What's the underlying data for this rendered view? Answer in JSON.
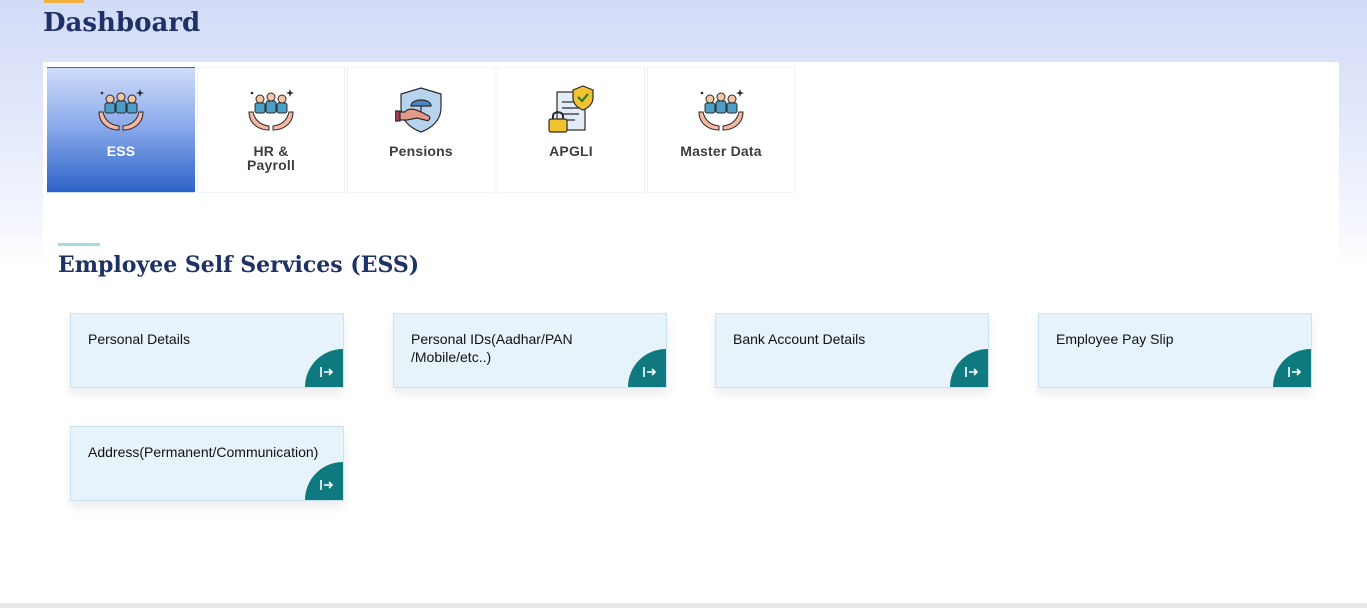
{
  "page": {
    "title": "Dashboard"
  },
  "tabs": [
    {
      "label": "ESS",
      "icon": "people-hands-icon",
      "active": true
    },
    {
      "label": "HR &\nPayroll",
      "icon": "people-hands-icon",
      "active": false
    },
    {
      "label": "Pensions",
      "icon": "umbrella-hand-icon",
      "active": false
    },
    {
      "label": "APGLI",
      "icon": "policy-lock-icon",
      "active": false
    },
    {
      "label": "Master Data",
      "icon": "people-hands-icon",
      "active": false
    }
  ],
  "section": {
    "title": "Employee Self Services (ESS)"
  },
  "cards": [
    {
      "title": "Personal Details",
      "action_icon": "arrow-right-icon"
    },
    {
      "title": "Personal IDs(Aadhar/PAN\n/Mobile/etc..)",
      "action_icon": "arrow-right-icon"
    },
    {
      "title": "Bank Account Details",
      "action_icon": "arrow-right-icon"
    },
    {
      "title": "Employee Pay Slip",
      "action_icon": "arrow-right-icon"
    },
    {
      "title": "Address(Permanent/Communication)",
      "action_icon": "arrow-right-icon"
    }
  ],
  "colors": {
    "heading": "#1f3266",
    "active_tab": "#2d63c9",
    "card_bg": "#e7f3fb",
    "card_action": "#0e7a80"
  }
}
